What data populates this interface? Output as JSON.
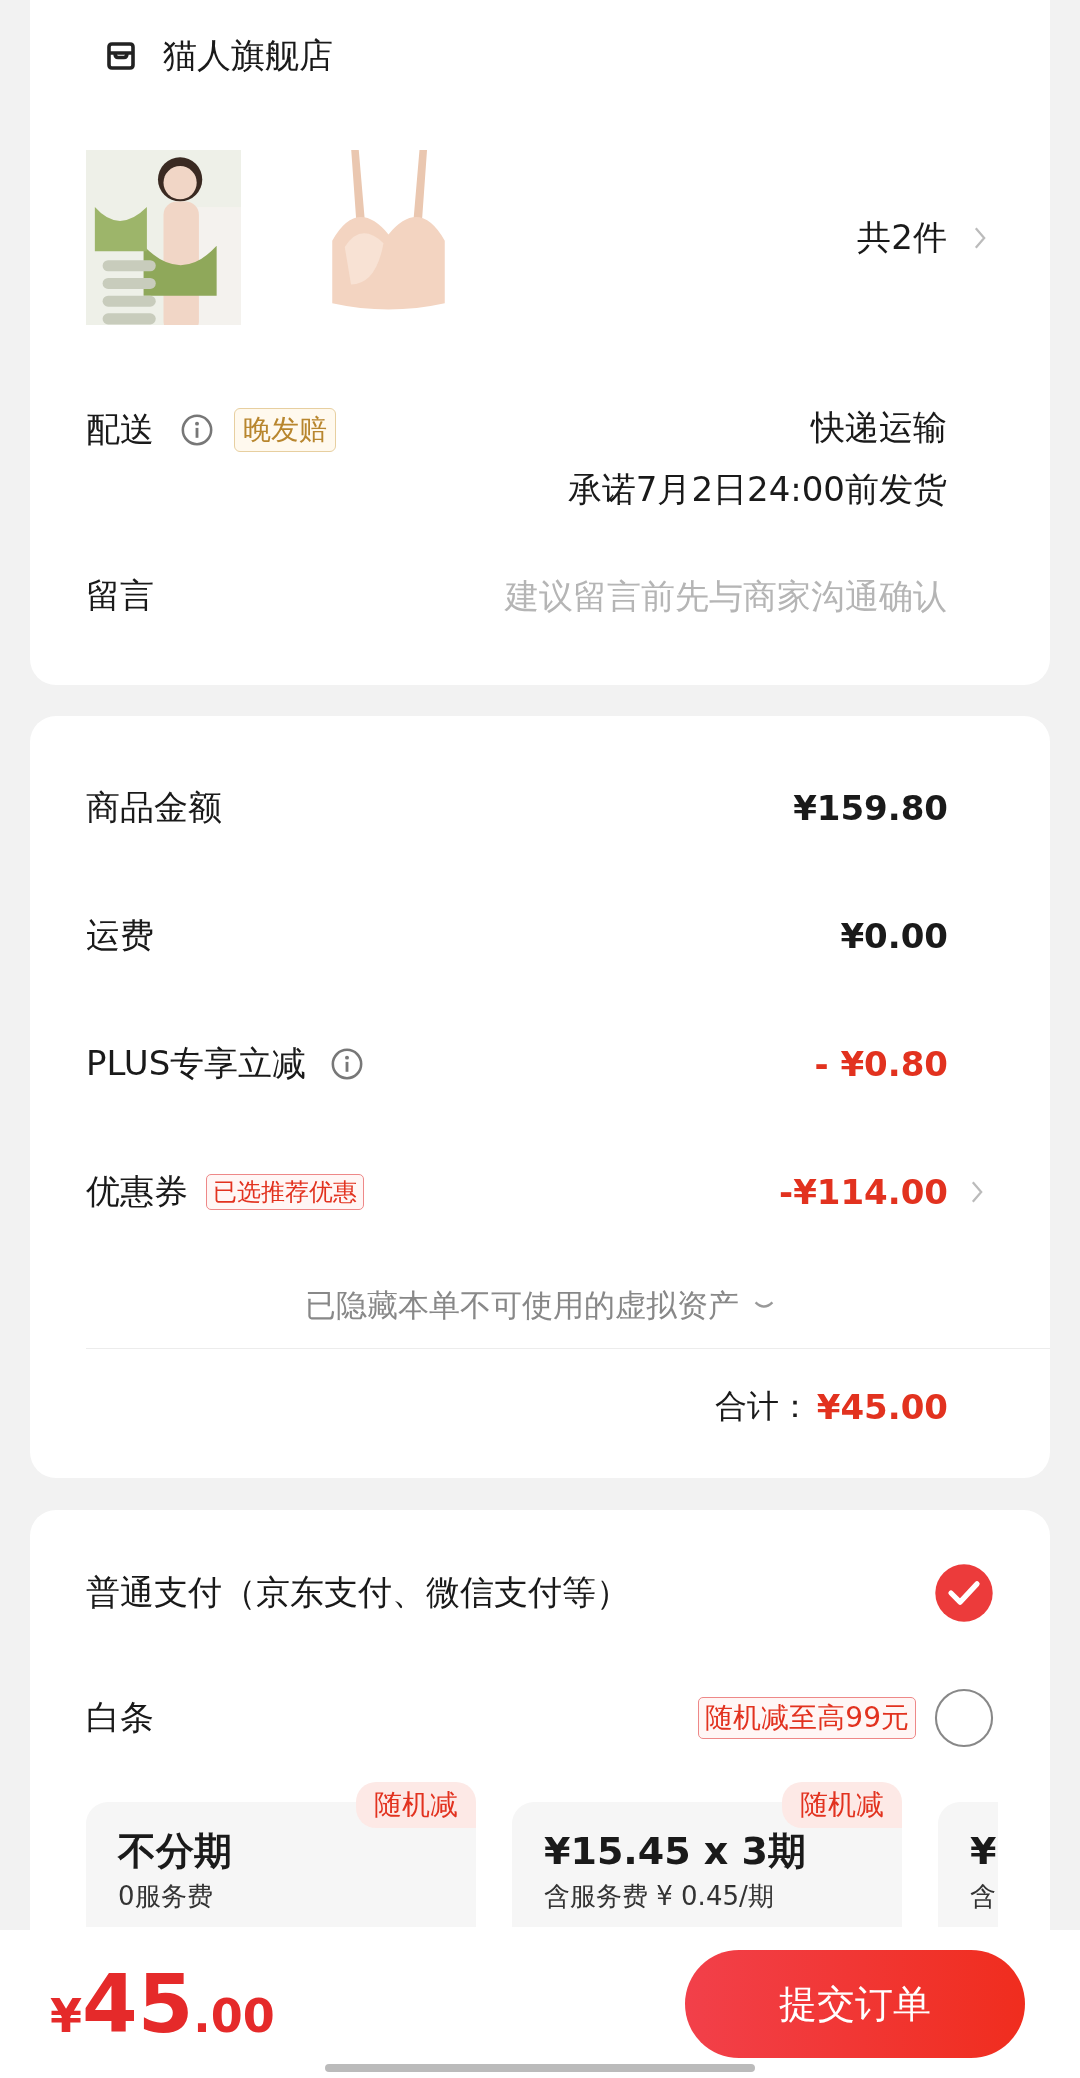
{
  "store": {
    "name": "猫人旗舰店"
  },
  "products": {
    "count": "共2件"
  },
  "delivery": {
    "label": "配送",
    "badge": "晚发赔",
    "method": "快递运输",
    "promise": "承诺7月2日24:00前发货"
  },
  "message": {
    "label": "留言",
    "placeholder": "建议留言前先与商家沟通确认"
  },
  "price_rows": [
    {
      "kind": "plain",
      "label": "商品金额",
      "value": "¥159.80"
    },
    {
      "kind": "plain",
      "label": "运费",
      "value": "¥0.00"
    },
    {
      "kind": "info",
      "label": "PLUS专享立减",
      "value": "- ¥0.80"
    },
    {
      "kind": "coupon",
      "label": "优惠券",
      "tag": "已选推荐优惠",
      "value": "-¥114.00"
    }
  ],
  "hidden_assets": "已隐藏本单不可使用的虚拟资产",
  "total": {
    "label": "合计：",
    "value": "¥45.00"
  },
  "payments": [
    {
      "label": "普通支付（京东支付、微信支付等）",
      "selected": true
    },
    {
      "label": "白条",
      "tag": "随机减至高99元",
      "selected": false
    }
  ],
  "installments": [
    {
      "badge": "随机减",
      "title": "不分期",
      "subtitle": "0服务费"
    },
    {
      "badge": "随机减",
      "title": "¥15.45 x 3期",
      "subtitle": "含服务费 ¥ 0.45/期"
    },
    {
      "title": "¥",
      "subtitle": "含"
    }
  ],
  "footer": {
    "currency": "¥",
    "integer": "45",
    "decimal": ".00",
    "submit": "提交订单"
  }
}
